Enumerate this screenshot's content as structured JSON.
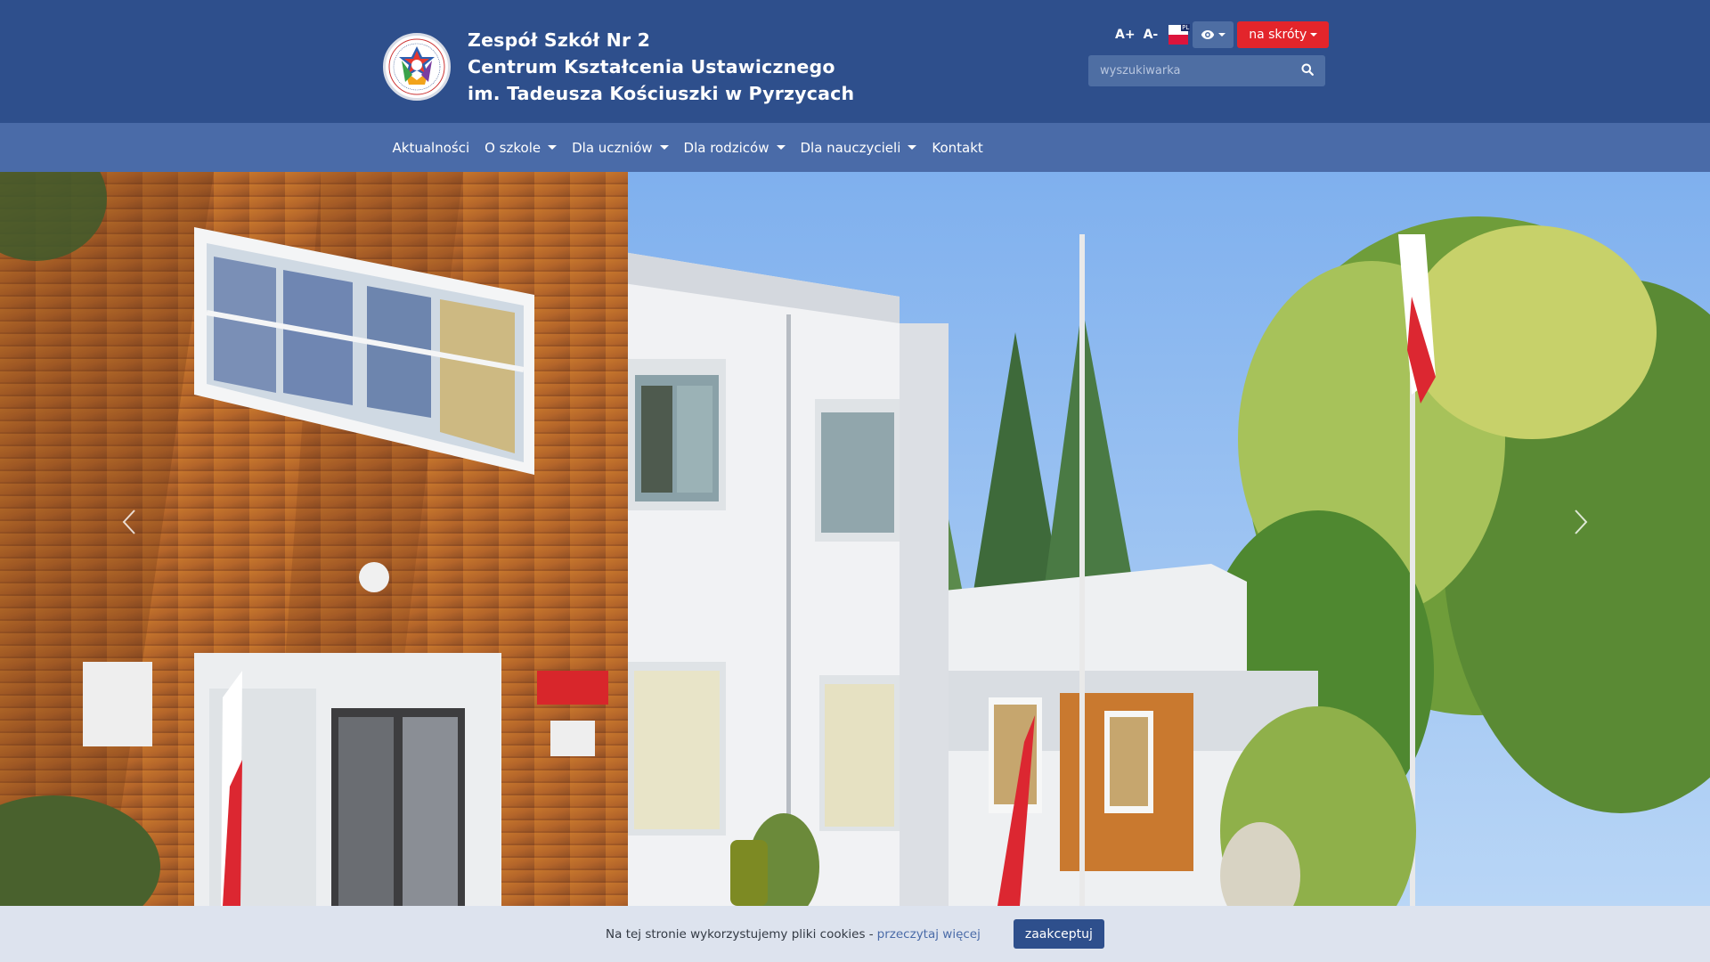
{
  "header": {
    "school_name_lines": [
      "Zespół Szkół Nr 2",
      "Centrum Kształcenia Ustawicznego",
      "im. Tadeusza Kościuszki w Pyrzycach"
    ],
    "logo_icon": "school-crest-logo",
    "font_increase_label": "A+",
    "font_decrease_label": "A-",
    "language_flag": "polish-flag-icon",
    "contrast_icon": "eye-icon",
    "shortcut_label": "na skróty",
    "search": {
      "placeholder": "wyszukiwarka",
      "value": "",
      "icon": "search-icon"
    }
  },
  "nav": {
    "items": [
      {
        "label": "Aktualności",
        "dropdown": false
      },
      {
        "label": "O szkole",
        "dropdown": true
      },
      {
        "label": "Dla uczniów",
        "dropdown": true
      },
      {
        "label": "Dla rodziców",
        "dropdown": true
      },
      {
        "label": "Dla nauczycieli",
        "dropdown": true
      },
      {
        "label": "Kontakt",
        "dropdown": false
      }
    ]
  },
  "hero": {
    "image": "school-building-photo",
    "prev_icon": "chevron-left-icon",
    "next_icon": "chevron-right-icon"
  },
  "cookie": {
    "text": "Na tej stronie wykorzystujemy pliki cookies -",
    "link_label": "przeczytaj więcej",
    "accept_label": "zaakceptuj"
  },
  "colors": {
    "header_bg": "#2e4f8c",
    "nav_bg": "#4a6ba8",
    "accent_red": "#e3252b",
    "cookie_bg": "#dde3ee"
  }
}
